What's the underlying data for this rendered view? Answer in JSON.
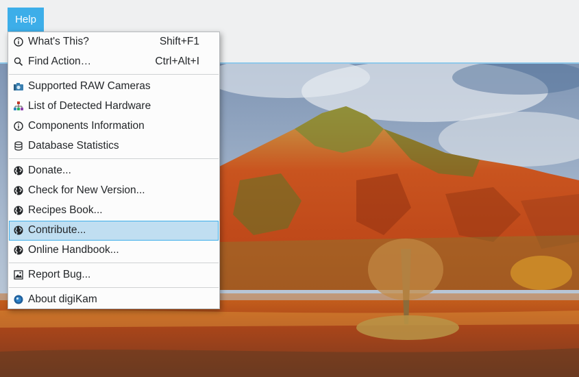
{
  "menubar": {
    "help_label": "Help"
  },
  "menu": {
    "items": [
      {
        "label": "What's This?",
        "shortcut": "Shift+F1",
        "icon": "info-icon"
      },
      {
        "label": "Find Action…",
        "shortcut": "Ctrl+Alt+I",
        "icon": "search-icon"
      },
      {
        "label": "Supported RAW Cameras",
        "icon": "camera-icon"
      },
      {
        "label": "List of Detected Hardware",
        "icon": "hardware-icon"
      },
      {
        "label": "Components Information",
        "icon": "info-icon"
      },
      {
        "label": "Database Statistics",
        "icon": "database-icon"
      },
      {
        "label": "Donate...",
        "icon": "globe-icon"
      },
      {
        "label": "Check for New Version...",
        "icon": "globe-icon"
      },
      {
        "label": "Recipes Book...",
        "icon": "globe-icon"
      },
      {
        "label": "Contribute...",
        "icon": "globe-icon",
        "highlighted": true
      },
      {
        "label": "Online Handbook...",
        "icon": "globe-icon"
      },
      {
        "label": "Report Bug...",
        "icon": "bug-report-icon"
      },
      {
        "label": "About digiKam",
        "icon": "digikam-logo-icon"
      }
    ]
  },
  "colors": {
    "accent": "#3daee9",
    "highlight": "#c0def1",
    "menu_bg": "#fcfcfc",
    "text": "#232629"
  }
}
